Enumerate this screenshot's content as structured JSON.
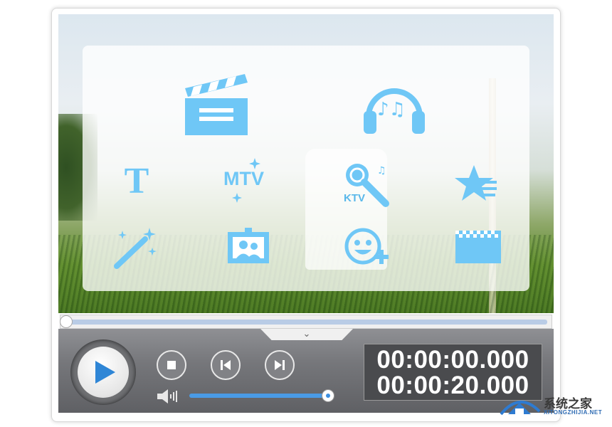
{
  "player": {
    "time_current": "00:00:00.000",
    "time_total": "00:00:20.000",
    "seek_position": 0.0,
    "volume_level": 0.97
  },
  "tools": {
    "text_label": "T",
    "mtv_label": "MTV",
    "ktv_label": "KTV"
  },
  "watermark": {
    "title": "系统之家",
    "url": "XITONGZHIJIA.NET"
  },
  "colors": {
    "icon_blue": "#6fc7f6",
    "accent_blue": "#3d8fe0"
  }
}
